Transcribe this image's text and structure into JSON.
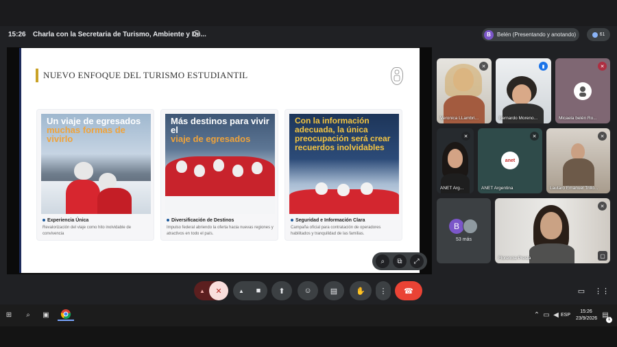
{
  "header": {
    "time": "15:26",
    "meeting_title": "Charla con la Secretaria de Turismo, Ambiente y De...",
    "info_icon": "info-icon",
    "presenter_initial": "B",
    "presenter_label": "Belén (Presentando y anotando)",
    "participants_count": "61"
  },
  "slide": {
    "title": "NUEVO ENFOQUE DEL TURISMO ESTUDIANTIL",
    "cards": [
      {
        "headline_a": "Un viaje de egresados",
        "headline_b": "muchas formas de vivirlo",
        "caption_title": "Experiencia Única",
        "caption_desc": "Revalorización del viaje como hito inolvidable de convivencia"
      },
      {
        "headline_a": "Más destinos para vivir el",
        "headline_b": "viaje de egresados",
        "caption_title": "Diversificación de Destinos",
        "caption_desc": "Impulso federal abriendo la oferta hacia nuevas regiones y atractivos en todo el país."
      },
      {
        "headline_a": "Con la información adecuada, la única preocupación será crear recuerdos inolvidables",
        "headline_b": "",
        "caption_title": "Seguridad e Información Clara",
        "caption_desc": "Campaña oficial para contratación de operadores habilitados y tranquilidad de las familias."
      }
    ],
    "tools": [
      "zoom-in-icon",
      "open-external-icon",
      "fullscreen-icon"
    ]
  },
  "participants": [
    {
      "name": "Veronica LLambri...",
      "mic": "muted"
    },
    {
      "name": "Bernardo Moreno...",
      "mic": "speaking"
    },
    {
      "name": "Micaela belén Ro...",
      "mic": "muted-red"
    },
    {
      "name": "ANET Arg...",
      "mic": "muted"
    },
    {
      "name": "ANET Argentina",
      "mic": "muted"
    },
    {
      "name": "Lautaro Emanuel Trillo...",
      "mic": "muted"
    },
    {
      "name": "53 más",
      "initial": "B"
    },
    {
      "name": "Florencia Presta",
      "mic": "muted"
    }
  ],
  "controls": {
    "more_options": "more-options-icon",
    "end_call": "end-call-icon",
    "chat_icon": "chat-icon",
    "apps_icon": "apps-grid-icon"
  },
  "taskbar": {
    "lang": "ESP",
    "clock_time": "15:26",
    "clock_date": "23/9/2026",
    "notification_count": "1"
  },
  "colors": {
    "accent_gold": "#c9a227",
    "end_call_red": "#ea4335",
    "speaking_blue": "#1a73e8"
  }
}
